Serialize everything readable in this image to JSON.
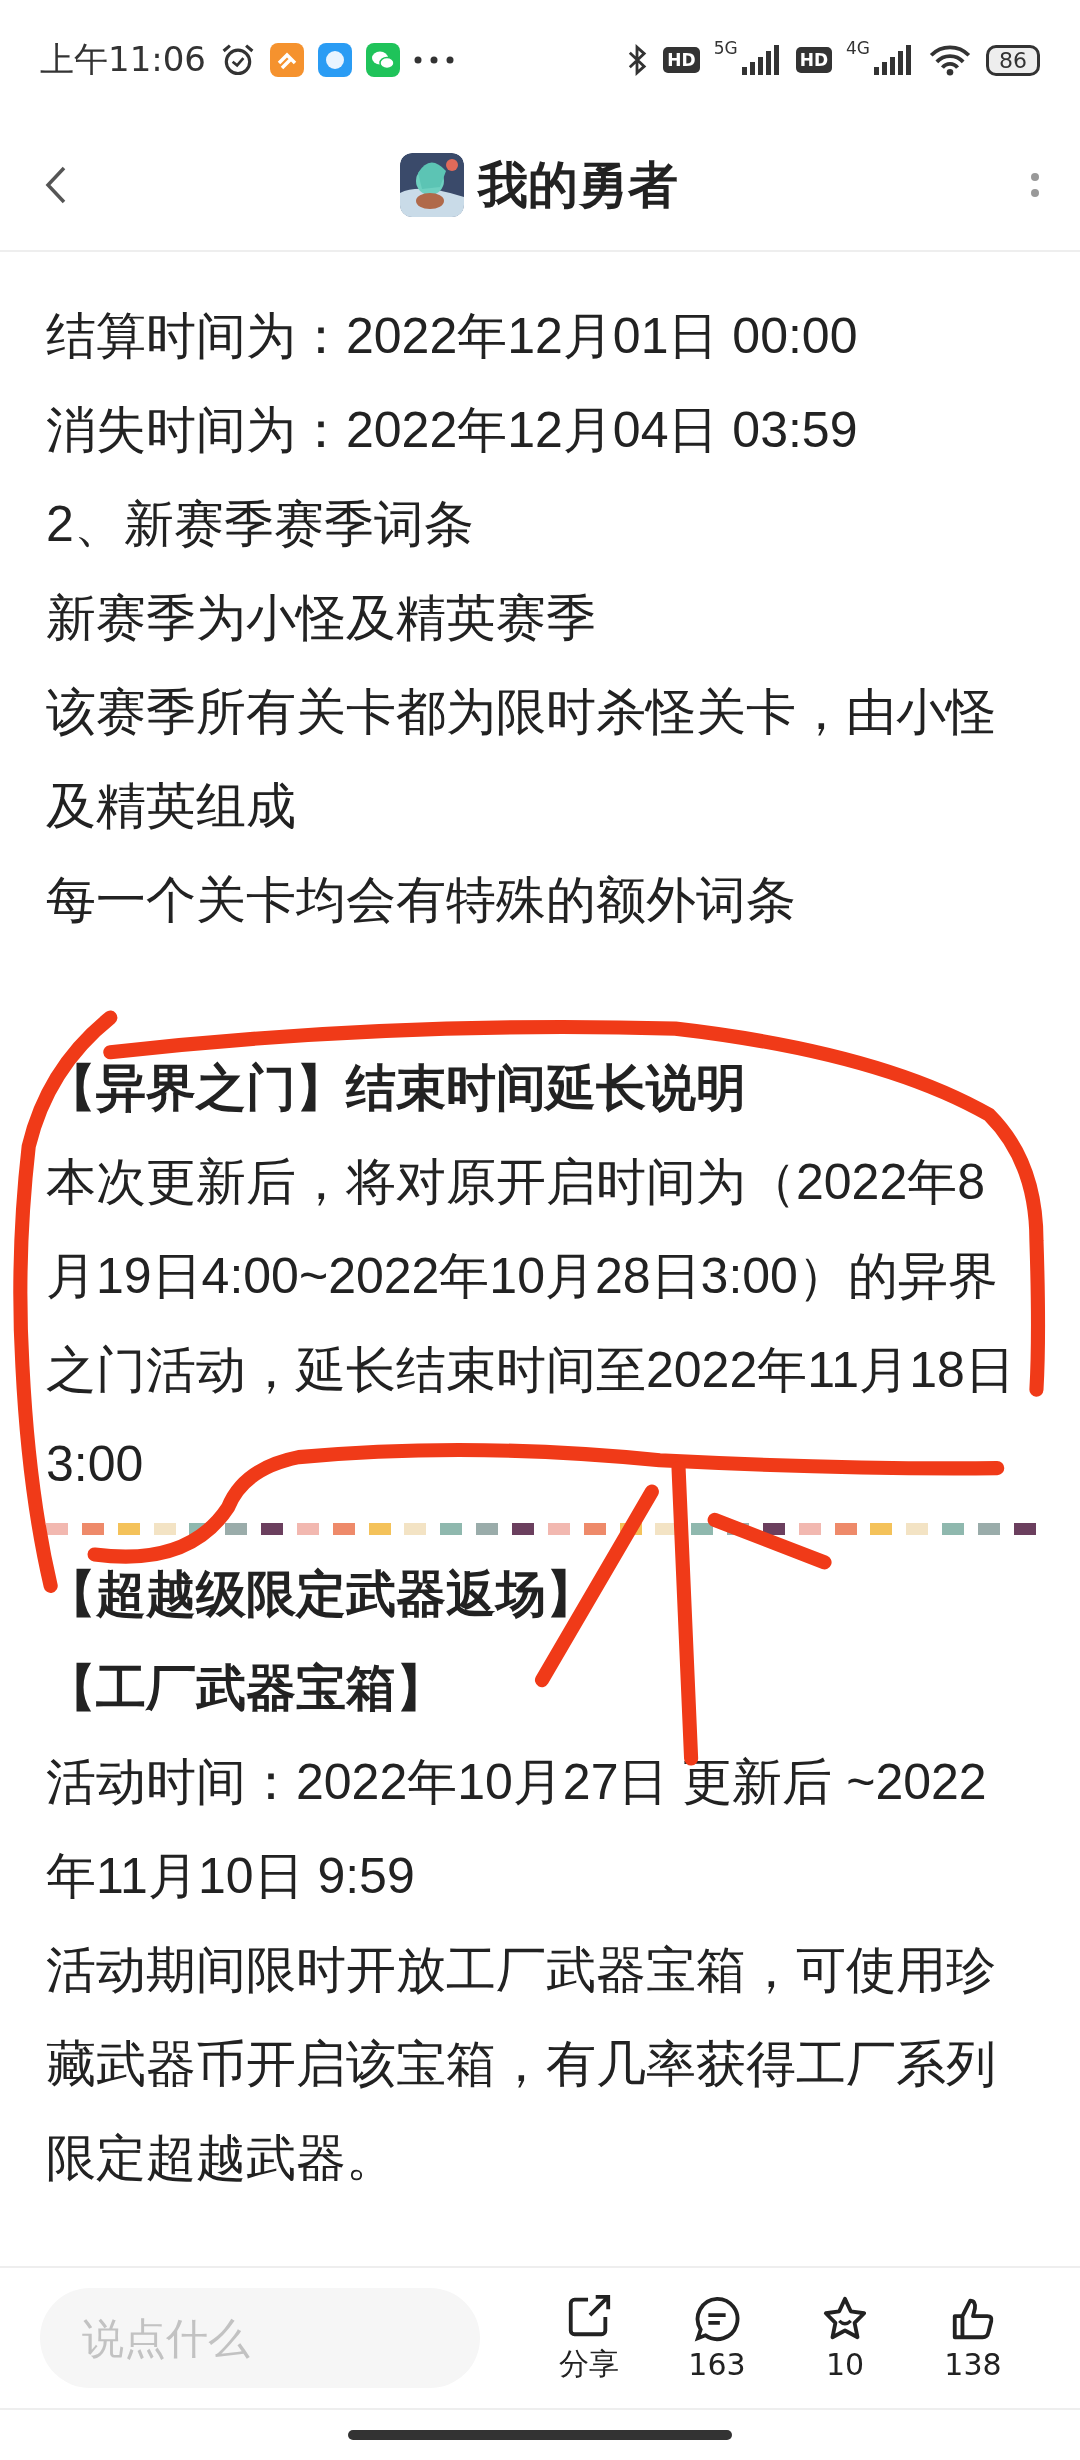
{
  "status_bar": {
    "time": "上午11:06",
    "hd_badges": [
      "HD",
      "HD"
    ],
    "networks": [
      "5G",
      "4G"
    ],
    "battery": "86"
  },
  "header": {
    "title": "我的勇者"
  },
  "content": [
    {
      "kind": "line",
      "text": "结算时间为：2022年12月01日 00:00"
    },
    {
      "kind": "line",
      "text": "消失时间为：2022年12月04日 03:59"
    },
    {
      "kind": "line",
      "text": "2、新赛季赛季词条"
    },
    {
      "kind": "line",
      "text": "新赛季为小怪及精英赛季"
    },
    {
      "kind": "line",
      "text": "该赛季所有关卡都为限时杀怪关卡，由小怪及精英组成"
    },
    {
      "kind": "line",
      "text": "每一个关卡均会有特殊的额外词条"
    },
    {
      "kind": "spacer"
    },
    {
      "kind": "heading",
      "text": "【异界之门】结束时间延长说明"
    },
    {
      "kind": "line",
      "text": "本次更新后，将对原开启时间为（2022年8月19日4:00~2022年10月28日3:00）的异界之门活动，延长结束时间至2022年11月18日3:00"
    },
    {
      "kind": "divider"
    },
    {
      "kind": "heading",
      "text": "【超越级限定武器返场】"
    },
    {
      "kind": "heading",
      "text": "【工厂武器宝箱】"
    },
    {
      "kind": "line",
      "text": "活动时间：2022年10月27日 更新后 ~2022年11月10日 9:59"
    },
    {
      "kind": "line",
      "text": "活动期间限时开放工厂武器宝箱，可使用珍藏武器币开启该宝箱，有几率获得工厂系列限定超越武器。"
    }
  ],
  "bottom_bar": {
    "placeholder": "说点什么",
    "actions": [
      {
        "kind": "share",
        "label": "分享"
      },
      {
        "kind": "comment",
        "label": "163"
      },
      {
        "kind": "favorite",
        "label": "10"
      },
      {
        "kind": "like",
        "label": "138"
      }
    ]
  }
}
